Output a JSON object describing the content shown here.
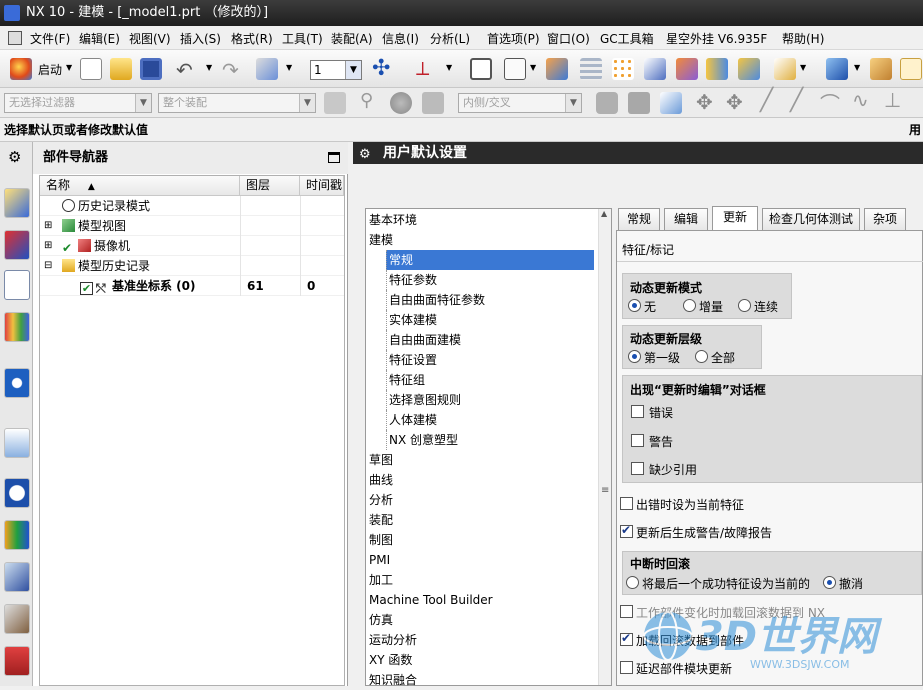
{
  "window": {
    "title": "NX 10 - 建模 - [_model1.prt （修改的）]"
  },
  "menu": [
    "文件(F)",
    "编辑(E)",
    "视图(V)",
    "插入(S)",
    "格式(R)",
    "工具(T)",
    "装配(A)",
    "信息(I)",
    "分析(L)",
    "首选项(P)",
    "窗口(O)",
    "GC工具箱",
    "星空外挂 V6.935F",
    "帮助(H)"
  ],
  "toolbar": {
    "start_label": "启动",
    "layer_value": "1"
  },
  "selection_bar": {
    "filter_placeholder": "无选择过滤器",
    "scope_placeholder": "整个装配",
    "snap_placeholder": "内侧/交叉"
  },
  "status": {
    "message": "选择默认页或者修改默认值",
    "right_text": "用"
  },
  "navigator": {
    "title": "部件导航器",
    "columns": [
      "名称",
      "图层",
      "时间戳"
    ],
    "rows": [
      {
        "name": "历史记录模式",
        "layer": "",
        "time": ""
      },
      {
        "name": "模型视图",
        "layer": "",
        "time": ""
      },
      {
        "name": "摄像机",
        "layer": "",
        "time": ""
      },
      {
        "name": "模型历史记录",
        "layer": "",
        "time": ""
      },
      {
        "name": "基准坐标系 (0)",
        "layer": "61",
        "time": "0"
      }
    ]
  },
  "dialog": {
    "title": "用户默认设置",
    "tree": [
      {
        "label": "基本环境",
        "level": 0
      },
      {
        "label": "建模",
        "level": 0
      },
      {
        "label": "常规",
        "level": 1,
        "selected": true
      },
      {
        "label": "特征参数",
        "level": 1
      },
      {
        "label": "自由曲面特征参数",
        "level": 1
      },
      {
        "label": "实体建模",
        "level": 1
      },
      {
        "label": "自由曲面建模",
        "level": 1
      },
      {
        "label": "特征设置",
        "level": 1
      },
      {
        "label": "特征组",
        "level": 1
      },
      {
        "label": "选择意图规则",
        "level": 1
      },
      {
        "label": "人体建模",
        "level": 1
      },
      {
        "label": "NX 创意塑型",
        "level": 1
      },
      {
        "label": "草图",
        "level": 0
      },
      {
        "label": "曲线",
        "level": 0
      },
      {
        "label": "分析",
        "level": 0
      },
      {
        "label": "装配",
        "level": 0
      },
      {
        "label": "制图",
        "level": 0
      },
      {
        "label": "PMI",
        "level": 0
      },
      {
        "label": "加工",
        "level": 0
      },
      {
        "label": "Machine Tool Builder",
        "level": 0
      },
      {
        "label": "仿真",
        "level": 0
      },
      {
        "label": "运动分析",
        "level": 0
      },
      {
        "label": "XY 函数",
        "level": 0
      },
      {
        "label": "知识融合",
        "level": 0
      }
    ],
    "tabs": [
      "常规",
      "编辑",
      "更新",
      "检查几何体测试",
      "杂项"
    ],
    "active_tab": "更新",
    "section_label": "特征/标记",
    "dynamic_update_mode": {
      "title": "动态更新模式",
      "options": [
        "无",
        "增量",
        "连续"
      ],
      "selected": "无"
    },
    "dynamic_update_level": {
      "title": "动态更新层级",
      "options": [
        "第一级",
        "全部"
      ],
      "selected": "第一级"
    },
    "edit_dialog": {
      "title": "出现“更新时编辑”对话框",
      "options": [
        "错误",
        "警告",
        "缺少引用"
      ]
    },
    "set_current_on_error": {
      "label": "出错时设为当前特征",
      "checked": false
    },
    "generate_warnings": {
      "label": "更新后生成警告/故障报告",
      "checked": true
    },
    "interrupt_rollback": {
      "title": "中断时回滚",
      "options": [
        "将最后一个成功特征设为当前的",
        "撤消"
      ],
      "selected": "撤消"
    },
    "work_part_rollback": {
      "label": "工作部件变化时加载回滚数据到 NX",
      "checked": false
    },
    "load_rollback": {
      "label": "加载回滚数据到部件",
      "checked": true
    },
    "delay_update": {
      "label": "延迟部件模块更新",
      "checked": false
    }
  },
  "watermark": {
    "logo": "3D世界网",
    "url": "WWW.3DSJW.COM"
  }
}
